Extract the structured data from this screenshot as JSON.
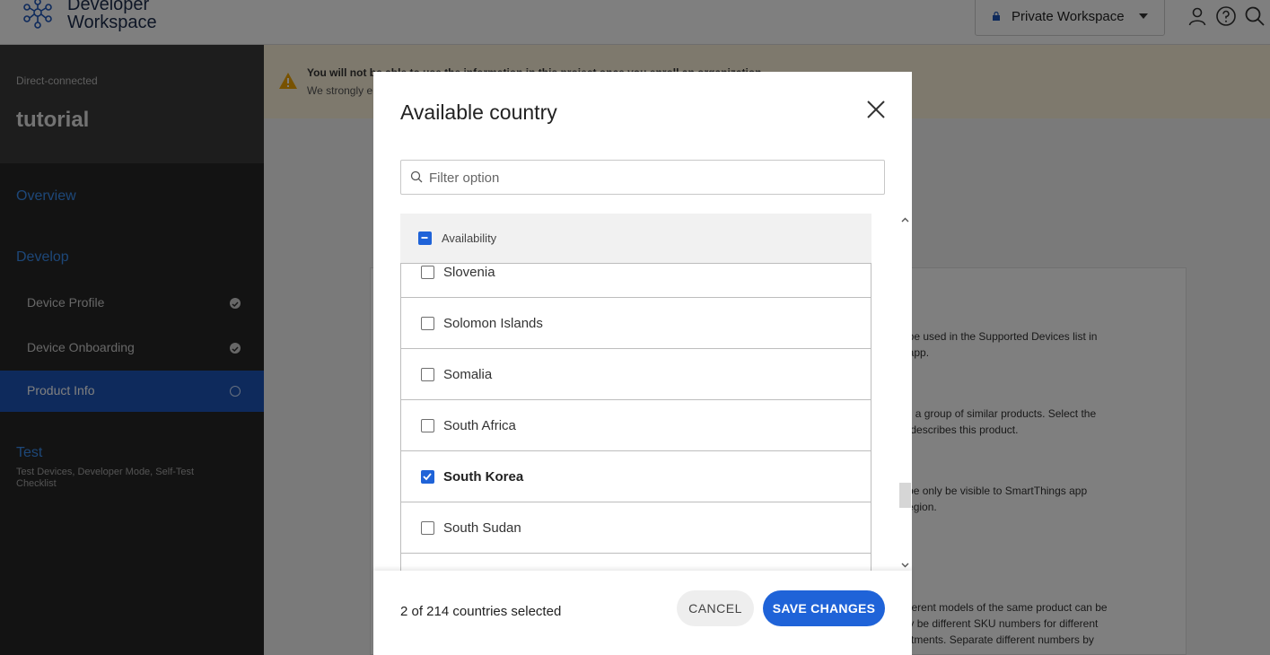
{
  "header": {
    "logo_line1": "Developer",
    "logo_line2": "Workspace",
    "workspace": "Private Workspace",
    "icons": [
      "lock-icon",
      "chevron-down-icon",
      "user-icon",
      "help-icon",
      "search-icon"
    ]
  },
  "sidebar": {
    "project_type": "Direct-connected",
    "project_name": "tutorial",
    "overview": "Overview",
    "develop": "Develop",
    "items": [
      {
        "label": "Device Profile",
        "status": "complete"
      },
      {
        "label": "Device Onboarding",
        "status": "complete"
      },
      {
        "label": "Product Info",
        "status": "in-progress"
      }
    ],
    "test": "Test",
    "test_sub": "Test Devices, Developer Mode, Self-Test Checklist"
  },
  "warning": {
    "line1": "You will not be able to use the information in this project once you enroll an organization.",
    "line2": "We strongly encourage you to enroll an organization to publish your project and to certify your devices with SmartThings."
  },
  "background_hints": [
    "ame will be used in the Supported Devices list in",
    "rtThings app.",
    "describes a group of similar products. Select the",
    "that best describes this product.",
    "duct will be only be visible to SmartThings app",
    "elected region.",
    "now if different models of the same product can be",
    "there may be different SKU numbers for different",
    "color treatments. Separate different numbers by"
  ],
  "modal": {
    "title": "Available country",
    "filter_placeholder": "Filter option",
    "header_label": "Availability",
    "countries": [
      {
        "name": "Slovenia",
        "checked": false
      },
      {
        "name": "Solomon Islands",
        "checked": false
      },
      {
        "name": "Somalia",
        "checked": false
      },
      {
        "name": "South Africa",
        "checked": false
      },
      {
        "name": "South Korea",
        "checked": true
      },
      {
        "name": "South Sudan",
        "checked": false
      }
    ],
    "selected_count": "2 of 214 countries selected",
    "cancel_label": "CANCEL",
    "save_label": "SAVE CHANGES"
  },
  "colors": {
    "accent": "#1f63d8",
    "sidebar_bg": "#2b2b2b",
    "warning_bg": "#fdf3da"
  }
}
